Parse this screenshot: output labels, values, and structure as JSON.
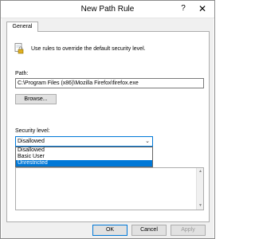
{
  "window": {
    "title": "New Path Rule",
    "help_glyph": "?",
    "close_glyph": "✕"
  },
  "tabs": [
    {
      "label": "General"
    }
  ],
  "general": {
    "description": "Use rules to override the default security level.",
    "path_label": "Path:",
    "path_value": "C:\\Program Files (x86)\\Mozilla Firefox\\firefox.exe",
    "browse_label": "Browse...",
    "security_label": "Security level:",
    "security_selected": "Disallowed",
    "security_options": [
      "Disallowed",
      "Basic User",
      "Unrestricted"
    ],
    "highlighted_option": "Unrestricted"
  },
  "buttons": {
    "ok": "OK",
    "cancel": "Cancel",
    "apply": "Apply"
  },
  "icons": {
    "rule": "document-lock-icon",
    "dropdown": "chevron-down-icon"
  }
}
